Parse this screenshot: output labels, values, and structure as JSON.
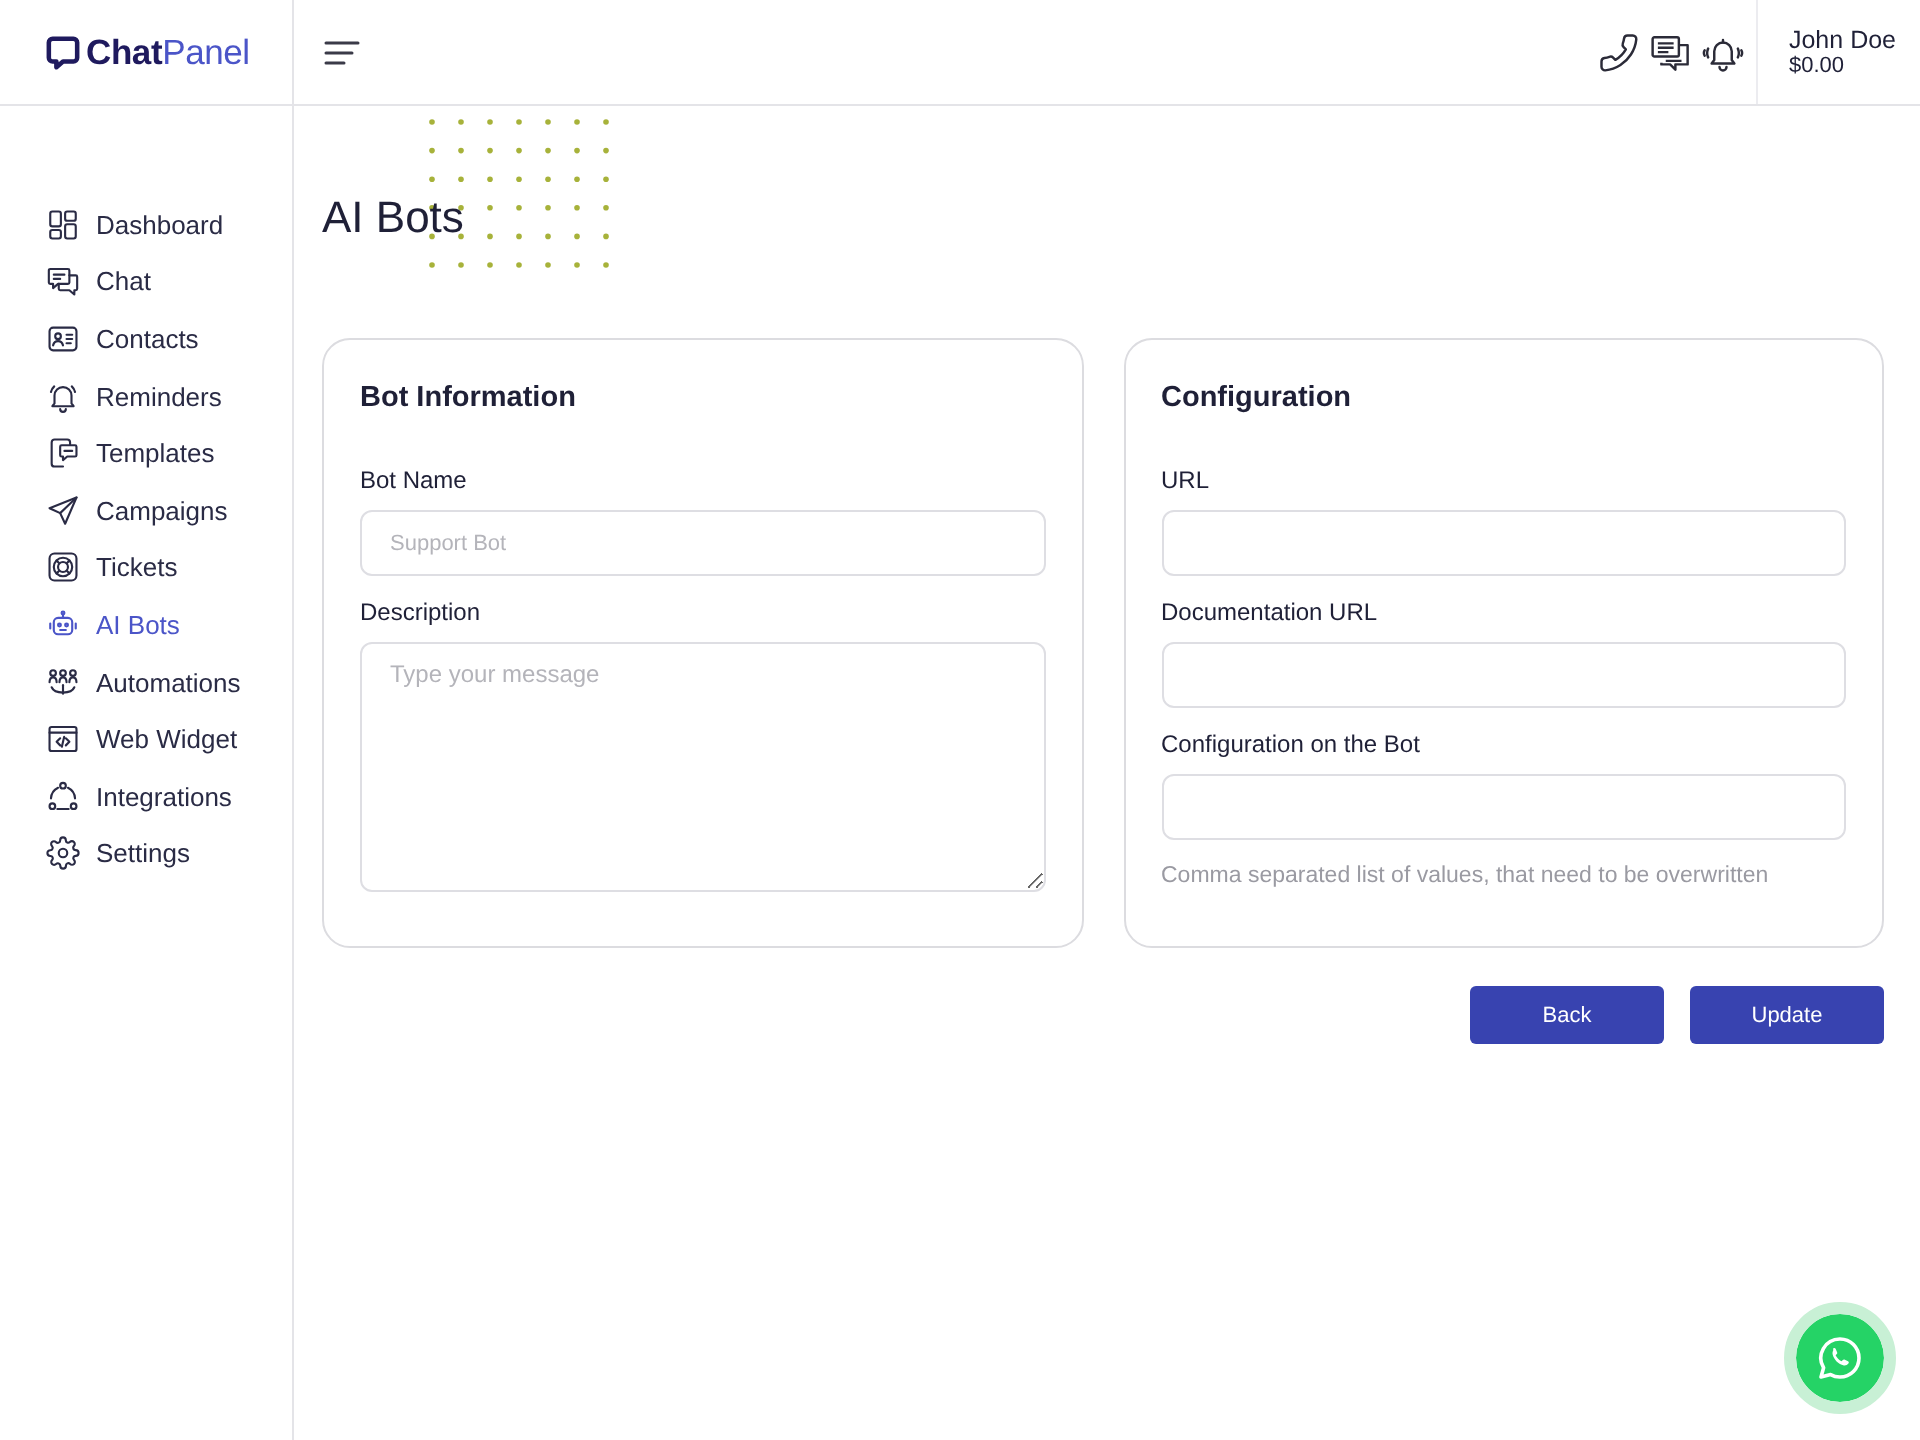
{
  "header": {
    "logo": "**Chat**Panel",
    "user": {
      "name": "John Doe",
      "balance": "$0.00"
    }
  },
  "sidebar": {
    "items": [
      {
        "label": "Dashboard",
        "selected": false
      },
      {
        "label": "Chat",
        "selected": false
      },
      {
        "label": "Contacts",
        "selected": false
      },
      {
        "label": "Reminders",
        "selected": false
      },
      {
        "label": "Templates",
        "selected": false
      },
      {
        "label": "Campaigns",
        "selected": false
      },
      {
        "label": "Tickets",
        "selected": false
      },
      {
        "label": "AI Bots",
        "selected": true
      },
      {
        "label": "Automations",
        "selected": false
      },
      {
        "label": "Web Widget",
        "selected": false
      },
      {
        "label": "Integrations",
        "selected": false
      },
      {
        "label": "Settings",
        "selected": false
      }
    ]
  },
  "page": {
    "title": "AI Bots"
  },
  "cards": [
    {
      "title": "Bot Information",
      "fields": [
        {
          "kind": "input",
          "label": "Bot Name",
          "placeholder": "Support Bot"
        },
        {
          "kind": "textarea",
          "label": "Description",
          "placeholder": "Type your message"
        }
      ]
    },
    {
      "title": "Configuration",
      "fields": [
        {
          "kind": "input",
          "label": "URL"
        },
        {
          "kind": "input",
          "label": "Documentation URL"
        },
        {
          "kind": "input",
          "label": "Configuration on the Bot",
          "help": "Comma separated list of values, that need to be overwritten"
        }
      ]
    }
  ],
  "buttons": [
    "Back",
    "Update"
  ]
}
